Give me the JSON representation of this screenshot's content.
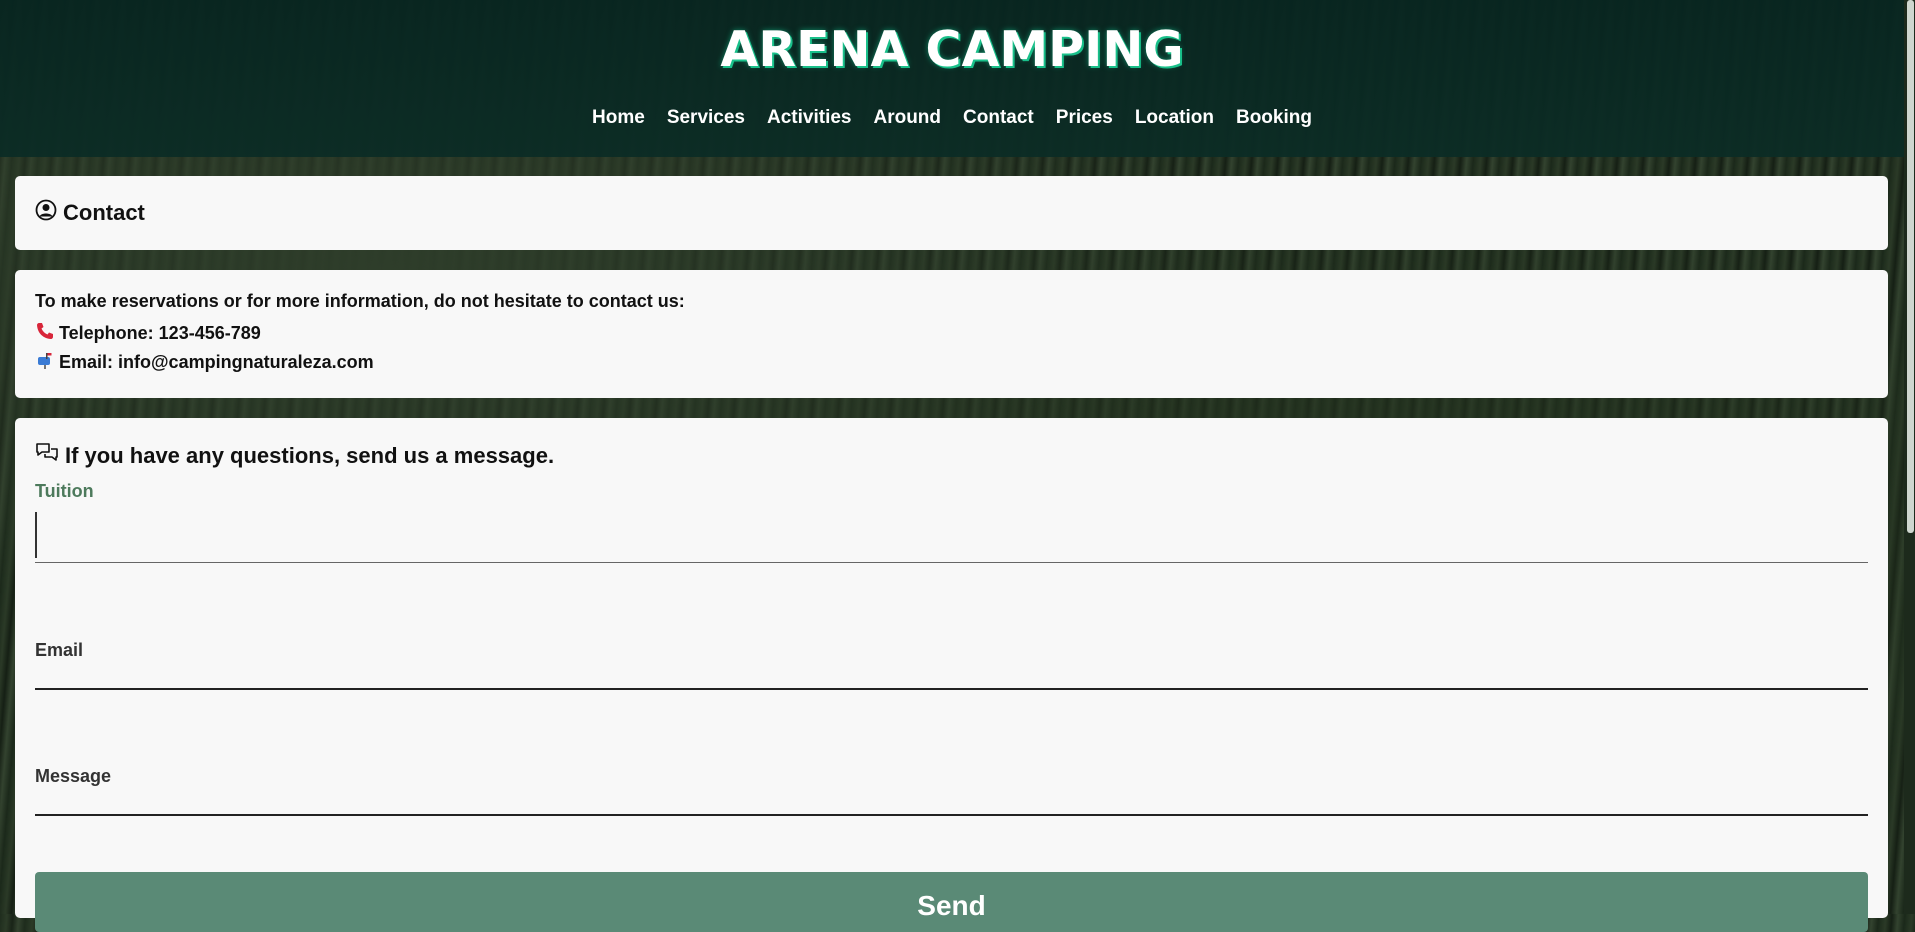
{
  "site": {
    "title": "ARENA CAMPING"
  },
  "nav": [
    "Home",
    "Services",
    "Activities",
    "Around",
    "Contact",
    "Prices",
    "Location",
    "Booking"
  ],
  "contact_header": {
    "title": "Contact",
    "icon": "user-circle-icon"
  },
  "info": {
    "intro": "To make reservations or for more information, do not hesitate to contact us:",
    "telephone": "Telephone: 123-456-789",
    "email": "Email: info@campingnaturaleza.com",
    "telephone_icon": "phone-icon",
    "email_icon": "mailbox-icon"
  },
  "form": {
    "title": "If you have any questions, send us a message.",
    "icon": "chat-bubbles-icon",
    "fields": [
      {
        "label": "Tuition",
        "value": ""
      },
      {
        "label": "Email",
        "value": ""
      },
      {
        "label": "Message",
        "value": ""
      }
    ],
    "submit_label": "Send"
  },
  "colors": {
    "header_bg": "#072520",
    "accent_title_glow": "#19c08a",
    "active_label": "#4d7a5c",
    "button_bg": "#5a8a76",
    "card_bg": "#f8f8f8"
  }
}
